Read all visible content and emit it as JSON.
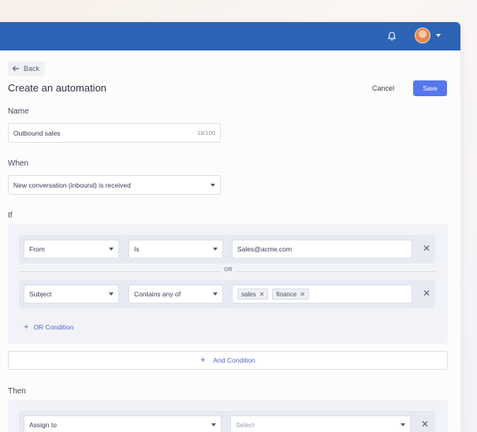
{
  "colors": {
    "header": "#2d64b5",
    "primary": "#5676ee",
    "link": "#5466c8"
  },
  "header": {
    "icons": [
      "bell-icon",
      "avatar",
      "chevron-down-icon"
    ]
  },
  "nav": {
    "back_label": "Back"
  },
  "page": {
    "title": "Create an automation",
    "cancel_label": "Cancel",
    "save_label": "Save"
  },
  "name_section": {
    "label": "Name",
    "value": "Outbound sales",
    "counter": "16/100"
  },
  "when_section": {
    "label": "When",
    "selected": "New conversation (inbound) is received"
  },
  "if_section": {
    "label": "If",
    "rows": [
      {
        "field": "From",
        "operator": "Is",
        "value": "Sales@acme.com"
      },
      {
        "field": "Subject",
        "operator": "Contains any of",
        "tags": [
          "sales",
          "finance"
        ]
      }
    ],
    "separator": "OR",
    "or_condition_label": "OR Condition"
  },
  "and_condition_label": "And Condition",
  "then_section": {
    "label": "Then",
    "action": "Assign to",
    "target_placeholder": "Select"
  }
}
